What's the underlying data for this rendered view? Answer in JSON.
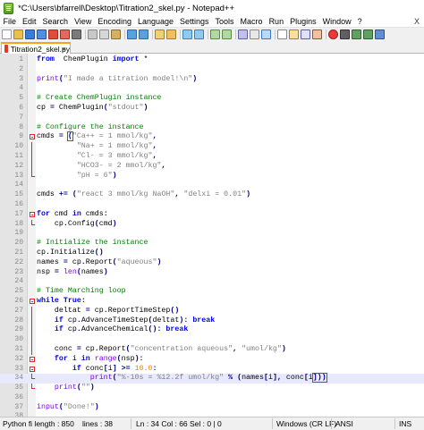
{
  "window": {
    "title": "*C:\\Users\\bfarrell\\Desktop\\Titration2_skel.py - Notepad++"
  },
  "menu": [
    "File",
    "Edit",
    "Search",
    "View",
    "Encoding",
    "Language",
    "Settings",
    "Tools",
    "Macro",
    "Run",
    "Plugins",
    "Window",
    "?"
  ],
  "menu_close": "X",
  "tab": {
    "label": "Titration2_skel.py",
    "close": "×"
  },
  "code": [
    {
      "n": "1",
      "t": [
        [
          "k",
          "from"
        ],
        [
          "",
          "  ChemPlugin "
        ],
        [
          "k",
          "import"
        ],
        [
          "",
          " *"
        ]
      ]
    },
    {
      "n": "2",
      "t": []
    },
    {
      "n": "3",
      "t": [
        [
          "b",
          "print"
        ],
        [
          "o",
          "("
        ],
        [
          "s",
          "\"I made a titration model!\\n\""
        ],
        [
          "o",
          ")"
        ]
      ]
    },
    {
      "n": "4",
      "t": []
    },
    {
      "n": "5",
      "t": [
        [
          "c",
          "# Create ChemPlugin instance"
        ]
      ]
    },
    {
      "n": "6",
      "t": [
        [
          "",
          "cp "
        ],
        [
          "o",
          "="
        ],
        [
          "",
          " ChemPlugin"
        ],
        [
          "o",
          "("
        ],
        [
          "s",
          "\"stdout\""
        ],
        [
          "o",
          ")"
        ]
      ]
    },
    {
      "n": "7",
      "t": []
    },
    {
      "n": "8",
      "t": [
        [
          "c",
          "# Configure the instance"
        ]
      ]
    },
    {
      "n": "9",
      "t": [
        [
          "",
          "cmds "
        ],
        [
          "o",
          "="
        ],
        [
          "",
          " "
        ],
        [
          "o",
          "("
        ],
        [
          "s",
          "\"Ca++ = 1 mmol/kg\""
        ],
        [
          "o",
          ","
        ]
      ],
      "fold": "box",
      "hl": true
    },
    {
      "n": "10",
      "t": [
        [
          "",
          "         "
        ],
        [
          "s",
          "\"Na+ = 1 mmol/kg\""
        ],
        [
          "o",
          ","
        ]
      ],
      "fold": "bar"
    },
    {
      "n": "11",
      "t": [
        [
          "",
          "         "
        ],
        [
          "s",
          "\"Cl- = 3 mmol/kg\""
        ],
        [
          "o",
          ","
        ]
      ],
      "fold": "bar"
    },
    {
      "n": "12",
      "t": [
        [
          "",
          "         "
        ],
        [
          "s",
          "\"HCO3- = 2 mmol/kg\""
        ],
        [
          "o",
          ","
        ]
      ],
      "fold": "bar"
    },
    {
      "n": "13",
      "t": [
        [
          "",
          "         "
        ],
        [
          "s",
          "\"pH = 6\""
        ],
        [
          "o",
          ")"
        ]
      ],
      "fold": "end"
    },
    {
      "n": "14",
      "t": []
    },
    {
      "n": "15",
      "t": [
        [
          "",
          "cmds "
        ],
        [
          "o",
          "+="
        ],
        [
          "",
          " "
        ],
        [
          "o",
          "("
        ],
        [
          "s",
          "\"react 3 mmol/kg NaOH\""
        ],
        [
          "o",
          ","
        ],
        [
          "",
          " "
        ],
        [
          "s",
          "\"delxi = 0.01\""
        ],
        [
          "o",
          ")"
        ]
      ]
    },
    {
      "n": "16",
      "t": []
    },
    {
      "n": "17",
      "t": [
        [
          "k",
          "for"
        ],
        [
          "",
          " cmd "
        ],
        [
          "k",
          "in"
        ],
        [
          "",
          " cmds"
        ],
        [
          "o",
          ":"
        ]
      ],
      "fold": "box"
    },
    {
      "n": "18",
      "t": [
        [
          "",
          "    cp"
        ],
        [
          "o",
          "."
        ],
        [
          "",
          "Config"
        ],
        [
          "o",
          "("
        ],
        [
          "",
          "cmd"
        ],
        [
          "o",
          ")"
        ]
      ],
      "fold": "end"
    },
    {
      "n": "19",
      "t": []
    },
    {
      "n": "20",
      "t": [
        [
          "c",
          "# Initialize the instance"
        ]
      ]
    },
    {
      "n": "21",
      "t": [
        [
          "",
          "cp"
        ],
        [
          "o",
          "."
        ],
        [
          "",
          "Initialize"
        ],
        [
          "o",
          "()"
        ]
      ]
    },
    {
      "n": "22",
      "t": [
        [
          "",
          "names "
        ],
        [
          "o",
          "="
        ],
        [
          "",
          " cp"
        ],
        [
          "o",
          "."
        ],
        [
          "",
          "Report"
        ],
        [
          "o",
          "("
        ],
        [
          "s",
          "\"aqueous\""
        ],
        [
          "o",
          ")"
        ]
      ]
    },
    {
      "n": "23",
      "t": [
        [
          "",
          "nsp "
        ],
        [
          "o",
          "="
        ],
        [
          "",
          " "
        ],
        [
          "b",
          "len"
        ],
        [
          "o",
          "("
        ],
        [
          "",
          "names"
        ],
        [
          "o",
          ")"
        ]
      ]
    },
    {
      "n": "24",
      "t": []
    },
    {
      "n": "25",
      "t": [
        [
          "c",
          "# Time Marching loop"
        ]
      ]
    },
    {
      "n": "26",
      "t": [
        [
          "k",
          "while"
        ],
        [
          "",
          " "
        ],
        [
          "k",
          "True"
        ],
        [
          "o",
          ":"
        ]
      ],
      "fold": "box"
    },
    {
      "n": "27",
      "t": [
        [
          "",
          "    deltat "
        ],
        [
          "o",
          "="
        ],
        [
          "",
          " cp"
        ],
        [
          "o",
          "."
        ],
        [
          "",
          "ReportTimeStep"
        ],
        [
          "o",
          "()"
        ]
      ],
      "fold": "bar"
    },
    {
      "n": "28",
      "t": [
        [
          "",
          "    "
        ],
        [
          "k",
          "if"
        ],
        [
          "",
          " cp"
        ],
        [
          "o",
          "."
        ],
        [
          "",
          "AdvanceTimeStep"
        ],
        [
          "o",
          "("
        ],
        [
          "",
          "deltat"
        ],
        [
          "o",
          "):"
        ],
        [
          "",
          " "
        ],
        [
          "k",
          "break"
        ]
      ],
      "fold": "bar"
    },
    {
      "n": "29",
      "t": [
        [
          "",
          "    "
        ],
        [
          "k",
          "if"
        ],
        [
          "",
          " cp"
        ],
        [
          "o",
          "."
        ],
        [
          "",
          "AdvanceChemical"
        ],
        [
          "o",
          "():"
        ],
        [
          "",
          " "
        ],
        [
          "k",
          "break"
        ]
      ],
      "fold": "bar"
    },
    {
      "n": "30",
      "t": [],
      "fold": "bar"
    },
    {
      "n": "31",
      "t": [
        [
          "",
          "    conc "
        ],
        [
          "o",
          "="
        ],
        [
          "",
          " cp"
        ],
        [
          "o",
          "."
        ],
        [
          "",
          "Report"
        ],
        [
          "o",
          "("
        ],
        [
          "s",
          "\"concentration aqueous\""
        ],
        [
          "o",
          ","
        ],
        [
          "",
          " "
        ],
        [
          "s",
          "\"umol/kg\""
        ],
        [
          "o",
          ")"
        ]
      ],
      "fold": "bar"
    },
    {
      "n": "32",
      "t": [
        [
          "",
          "    "
        ],
        [
          "k",
          "for"
        ],
        [
          "",
          " i "
        ],
        [
          "k",
          "in"
        ],
        [
          "",
          " "
        ],
        [
          "b",
          "range"
        ],
        [
          "o",
          "("
        ],
        [
          "",
          "nsp"
        ],
        [
          "o",
          "):"
        ]
      ],
      "fold": "box"
    },
    {
      "n": "33",
      "t": [
        [
          "",
          "        "
        ],
        [
          "k",
          "if"
        ],
        [
          "",
          " conc"
        ],
        [
          "o",
          "["
        ],
        [
          "",
          "i"
        ],
        [
          "o",
          "]"
        ],
        [
          "",
          " "
        ],
        [
          "o",
          ">="
        ],
        [
          "",
          " "
        ],
        [
          "n",
          "10.0"
        ],
        [
          "o",
          ":"
        ]
      ],
      "fold": "box"
    },
    {
      "n": "34",
      "t": [
        [
          "",
          "            "
        ],
        [
          "b",
          "print"
        ],
        [
          "o",
          "("
        ],
        [
          "s",
          "\"%-10s = %12.2f umol/kg\""
        ],
        [
          "",
          " "
        ],
        [
          "o",
          "%"
        ],
        [
          "",
          " "
        ],
        [
          "o",
          "("
        ],
        [
          "",
          "names"
        ],
        [
          "o",
          "["
        ],
        [
          "",
          "i"
        ],
        [
          "o",
          "],"
        ],
        [
          "",
          " conc"
        ],
        [
          "o",
          "["
        ],
        [
          "",
          "i"
        ],
        [
          "o",
          "]))"
        ]
      ],
      "fold": "end",
      "current": true
    },
    {
      "n": "35",
      "t": [
        [
          "",
          "    "
        ],
        [
          "b",
          "print"
        ],
        [
          "o",
          "("
        ],
        [
          "s",
          "\"\""
        ],
        [
          "o",
          ")"
        ]
      ],
      "fold": "end"
    },
    {
      "n": "36",
      "t": []
    },
    {
      "n": "37",
      "t": [
        [
          "b",
          "input"
        ],
        [
          "o",
          "("
        ],
        [
          "s",
          "\"Done!\""
        ],
        [
          "o",
          ")"
        ]
      ]
    },
    {
      "n": "38",
      "t": []
    }
  ],
  "status": {
    "file": "Python fi length : 850",
    "lines": "lines : 38",
    "pos": "Ln : 34   Col : 66   Sel : 0 | 0",
    "eol": "Windows (CR LF)",
    "enc": "ANSI",
    "mode": "INS"
  },
  "colors": {
    "keyword": "#0000ff",
    "string": "#808080",
    "comment": "#008000",
    "number": "#ff8000",
    "operator": "#000080",
    "builtin": "#8000ff"
  }
}
